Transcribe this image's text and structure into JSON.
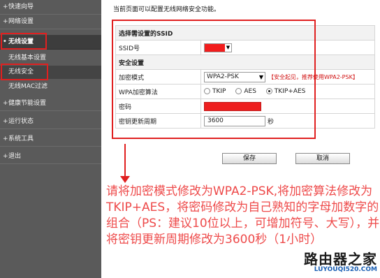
{
  "sidebar": {
    "items": [
      {
        "label": "快速向导"
      },
      {
        "label": "网络设置"
      },
      {
        "label": "无线设置"
      },
      {
        "label": "健康节能设置"
      },
      {
        "label": "运行状态"
      },
      {
        "label": "系统工具"
      },
      {
        "label": "退出"
      }
    ],
    "subitems": [
      {
        "label": "无线基本设置"
      },
      {
        "label": "无线安全"
      },
      {
        "label": "无线MAC过滤"
      }
    ]
  },
  "main": {
    "intro": "当前页面可以配置无线网络安全功能。",
    "section_ssid": "选择需设置的SSID",
    "ssid_label": "SSID号",
    "section_security": "安全设置",
    "mode_label": "加密模式",
    "mode_value": "WPA2-PSK",
    "mode_hint": "【安全起见，推荐使用WPA2-PSK】",
    "algo_label": "WPA加密算法",
    "algo_options": [
      "TKIP",
      "AES",
      "TKIP+AES"
    ],
    "algo_selected": "TKIP+AES",
    "password_label": "密码",
    "period_label": "密钥更新周期",
    "period_value": "3600",
    "period_unit": "秒",
    "save_button": "保存",
    "cancel_button": "取消"
  },
  "annotation": {
    "text": "请将加密模式修改为WPA2-PSK,将加密算法修改为TKIP+AES，将密码修改为自己熟知的字母加数字的组合（PS：建议10位以上，可增加符号、大写），并将密钥更新周期修改为3600秒（1小时）",
    "color": "#ee4a4a"
  },
  "watermark": {
    "logo": "路由器之家",
    "url": "LUYOUQI520.COM"
  }
}
